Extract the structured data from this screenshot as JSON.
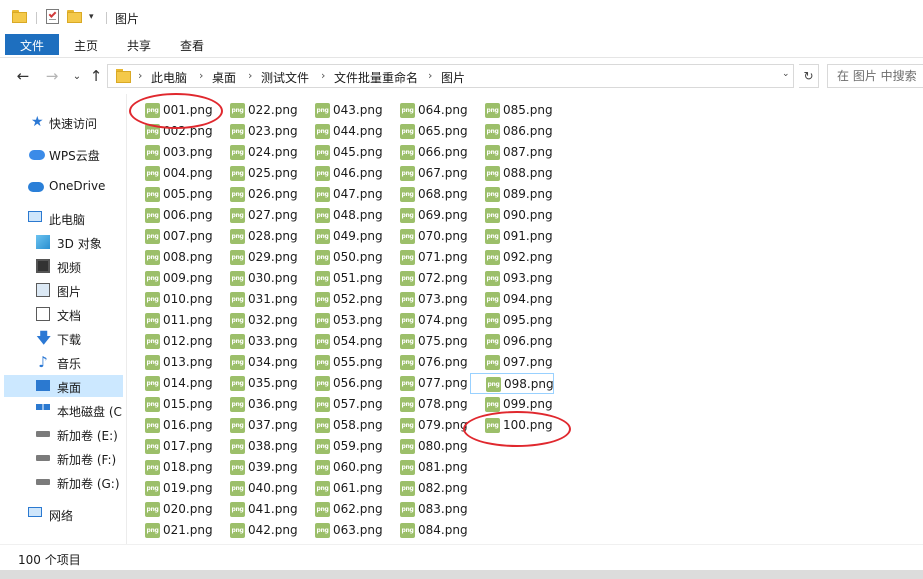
{
  "window": {
    "title": "图片"
  },
  "ribbon": {
    "tabs": [
      "文件",
      "主页",
      "共享",
      "查看"
    ]
  },
  "address": {
    "crumbs": [
      "此电脑",
      "桌面",
      "测试文件",
      "文件批量重命名",
      "图片"
    ],
    "search_placeholder": "在 图片 中搜索"
  },
  "nav": {
    "items": [
      {
        "label": "快速访问",
        "icon": "star-icon"
      },
      {
        "label": "WPS云盘",
        "icon": "wps-cloud-icon"
      },
      {
        "label": "OneDrive",
        "icon": "onedrive-cloud-icon"
      },
      {
        "label": "此电脑",
        "icon": "this-pc-icon"
      },
      {
        "label": "3D 对象",
        "icon": "3d-objects-icon"
      },
      {
        "label": "视频",
        "icon": "video-icon"
      },
      {
        "label": "图片",
        "icon": "pictures-icon"
      },
      {
        "label": "文档",
        "icon": "documents-icon"
      },
      {
        "label": "下载",
        "icon": "download-icon"
      },
      {
        "label": "音乐",
        "icon": "music-icon"
      },
      {
        "label": "桌面",
        "icon": "desktop-icon"
      },
      {
        "label": "本地磁盘 (C:",
        "icon": "local-disk-icon"
      },
      {
        "label": "新加卷 (E:)",
        "icon": "drive-icon"
      },
      {
        "label": "新加卷 (F:)",
        "icon": "drive-icon"
      },
      {
        "label": "新加卷 (G:)",
        "icon": "drive-icon"
      },
      {
        "label": "网络",
        "icon": "network-icon"
      }
    ],
    "selected": "桌面"
  },
  "files": {
    "icon_text": "png",
    "names": [
      "001.png",
      "002.png",
      "003.png",
      "004.png",
      "005.png",
      "006.png",
      "007.png",
      "008.png",
      "009.png",
      "010.png",
      "011.png",
      "012.png",
      "013.png",
      "014.png",
      "015.png",
      "016.png",
      "017.png",
      "018.png",
      "019.png",
      "020.png",
      "021.png",
      "022.png",
      "023.png",
      "024.png",
      "025.png",
      "026.png",
      "027.png",
      "028.png",
      "029.png",
      "030.png",
      "031.png",
      "032.png",
      "033.png",
      "034.png",
      "035.png",
      "036.png",
      "037.png",
      "038.png",
      "039.png",
      "040.png",
      "041.png",
      "042.png",
      "043.png",
      "044.png",
      "045.png",
      "046.png",
      "047.png",
      "048.png",
      "049.png",
      "050.png",
      "051.png",
      "052.png",
      "053.png",
      "054.png",
      "055.png",
      "056.png",
      "057.png",
      "058.png",
      "059.png",
      "060.png",
      "061.png",
      "062.png",
      "063.png",
      "064.png",
      "065.png",
      "066.png",
      "067.png",
      "068.png",
      "069.png",
      "070.png",
      "071.png",
      "072.png",
      "073.png",
      "074.png",
      "075.png",
      "076.png",
      "077.png",
      "078.png",
      "079.png",
      "080.png",
      "081.png",
      "082.png",
      "083.png",
      "084.png",
      "085.png",
      "086.png",
      "087.png",
      "088.png",
      "089.png",
      "090.png",
      "091.png",
      "092.png",
      "093.png",
      "094.png",
      "095.png",
      "096.png",
      "097.png",
      "098.png",
      "099.png",
      "100.png"
    ],
    "focused": "098.png",
    "highlighted": [
      "001.png",
      "100.png"
    ]
  },
  "status": {
    "item_count": "100 个项目"
  },
  "colors": {
    "accent": "#1e6fbf",
    "selection": "#cce8ff",
    "annotation": "#e0282e",
    "png_icon": "#9cbf6a"
  }
}
